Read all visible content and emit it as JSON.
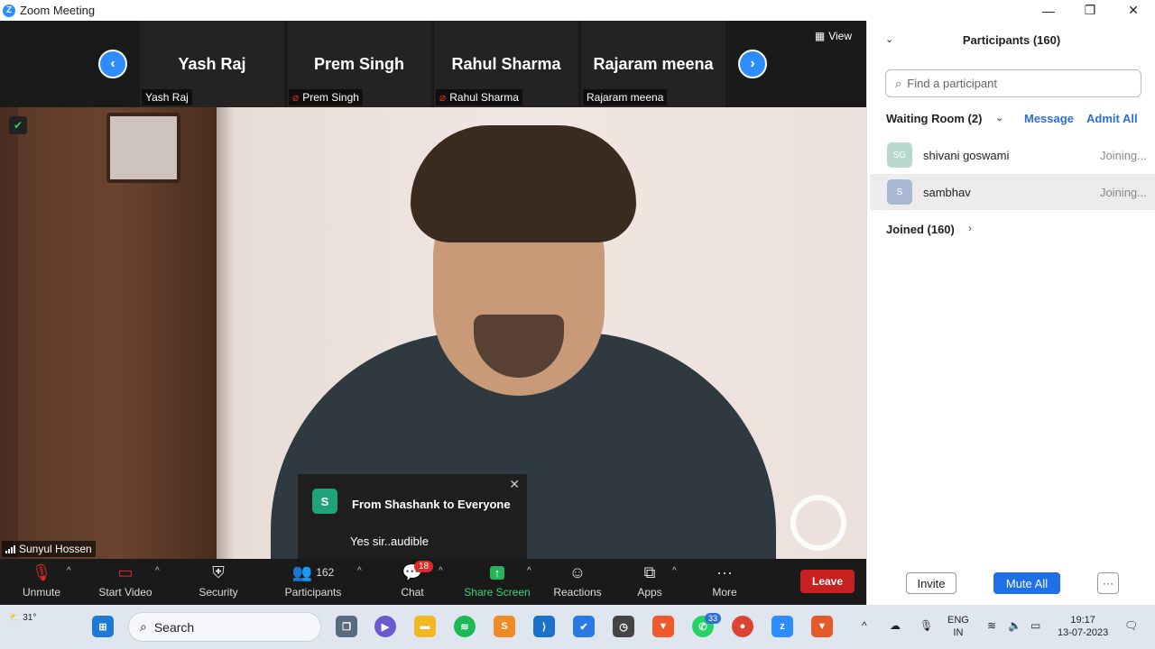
{
  "window": {
    "title": "Zoom Meeting",
    "logo": "Z",
    "min": "—",
    "max": "❐",
    "close": "✕"
  },
  "strip": {
    "view_label": "View",
    "tiles": [
      {
        "name": "Yash Raj",
        "label": "Yash Raj",
        "muted": false
      },
      {
        "name": "Prem Singh",
        "label": "Prem Singh",
        "muted": true
      },
      {
        "name": "Rahul Sharma",
        "label": "Rahul Sharma",
        "muted": true
      },
      {
        "name": "Rajaram meena",
        "label": "Rajaram meena",
        "muted": false
      }
    ],
    "prev_icon": "‹",
    "next_icon": "›"
  },
  "video": {
    "speaker_name": "Sunyul Hossen"
  },
  "chat_popup": {
    "avatar": "S",
    "from": "From Shashank to Everyone",
    "message": "Yes sir..audible",
    "close": "✕"
  },
  "toolbar": {
    "unmute": "Unmute",
    "start_video": "Start Video",
    "security": "Security",
    "participants": "Participants",
    "participants_count": "162",
    "chat": "Chat",
    "chat_badge": "18",
    "share_screen": "Share Screen",
    "reactions": "Reactions",
    "apps": "Apps",
    "more": "More",
    "leave": "Leave"
  },
  "panel": {
    "title": "Participants (160)",
    "search_placeholder": "Find a participant",
    "waiting_room": "Waiting Room (2)",
    "message": "Message",
    "admit_all": "Admit All",
    "waiting": [
      {
        "initials": "SG",
        "name": "shivani goswami",
        "status": "Joining...",
        "color": "#b9d8cc"
      },
      {
        "initials": "S",
        "name": "sambhav",
        "status": "Joining...",
        "color": "#aab8d6"
      }
    ],
    "joined": "Joined (160)",
    "invite": "Invite",
    "mute_all": "Mute All",
    "more": "···"
  },
  "taskbar": {
    "weather": "31°",
    "search": "Search",
    "whatsapp_badge": "33",
    "lang1": "ENG",
    "lang2": "IN",
    "time": "19:17",
    "date": "13-07-2023"
  }
}
